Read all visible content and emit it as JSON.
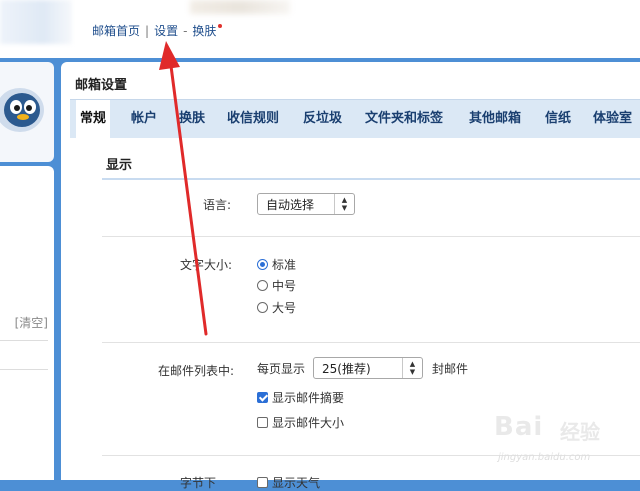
{
  "top_links": {
    "home": "邮箱首页",
    "separator": "|",
    "settings": "设置",
    "dash": "-",
    "skin": "换肤"
  },
  "sidebar": {
    "clear_label": "[清空]"
  },
  "settings_panel": {
    "title": "邮箱设置",
    "tabs": [
      {
        "label": "常规",
        "active": true
      },
      {
        "label": "帐户",
        "active": false
      },
      {
        "label": "换肤",
        "active": false
      },
      {
        "label": "收信规则",
        "active": false
      },
      {
        "label": "反垃圾",
        "active": false
      },
      {
        "label": "文件夹和标签",
        "active": false
      },
      {
        "label": "其他邮箱",
        "active": false
      },
      {
        "label": "信纸",
        "active": false
      },
      {
        "label": "体验室",
        "active": false
      }
    ],
    "section_title": "显示",
    "language": {
      "label": "语言:",
      "value": "自动选择"
    },
    "font_size": {
      "label": "文字大小:",
      "options": [
        {
          "label": "标准",
          "selected": true
        },
        {
          "label": "中号",
          "selected": false
        },
        {
          "label": "大号",
          "selected": false
        }
      ]
    },
    "mail_list": {
      "label": "在邮件列表中:",
      "per_page_prefix": "每页显示",
      "per_page_value": "25(推荐)",
      "per_page_suffix": "封邮件",
      "show_summary": {
        "label": "显示邮件摘要",
        "checked": true
      },
      "show_size": {
        "label": "显示邮件大小",
        "checked": false
      }
    },
    "cutoff_row": {
      "label": "字节下",
      "option": "显示天气"
    }
  },
  "watermark": {
    "brand": "Bai",
    "cn": "经验",
    "url": "jingyan.baidu.com"
  },
  "colors": {
    "background": "#4d8fd5",
    "tab_bar": "#dbe8f5",
    "arrow": "#e02a2a",
    "link": "#1f4e8c",
    "accent": "#2b6fd6"
  }
}
